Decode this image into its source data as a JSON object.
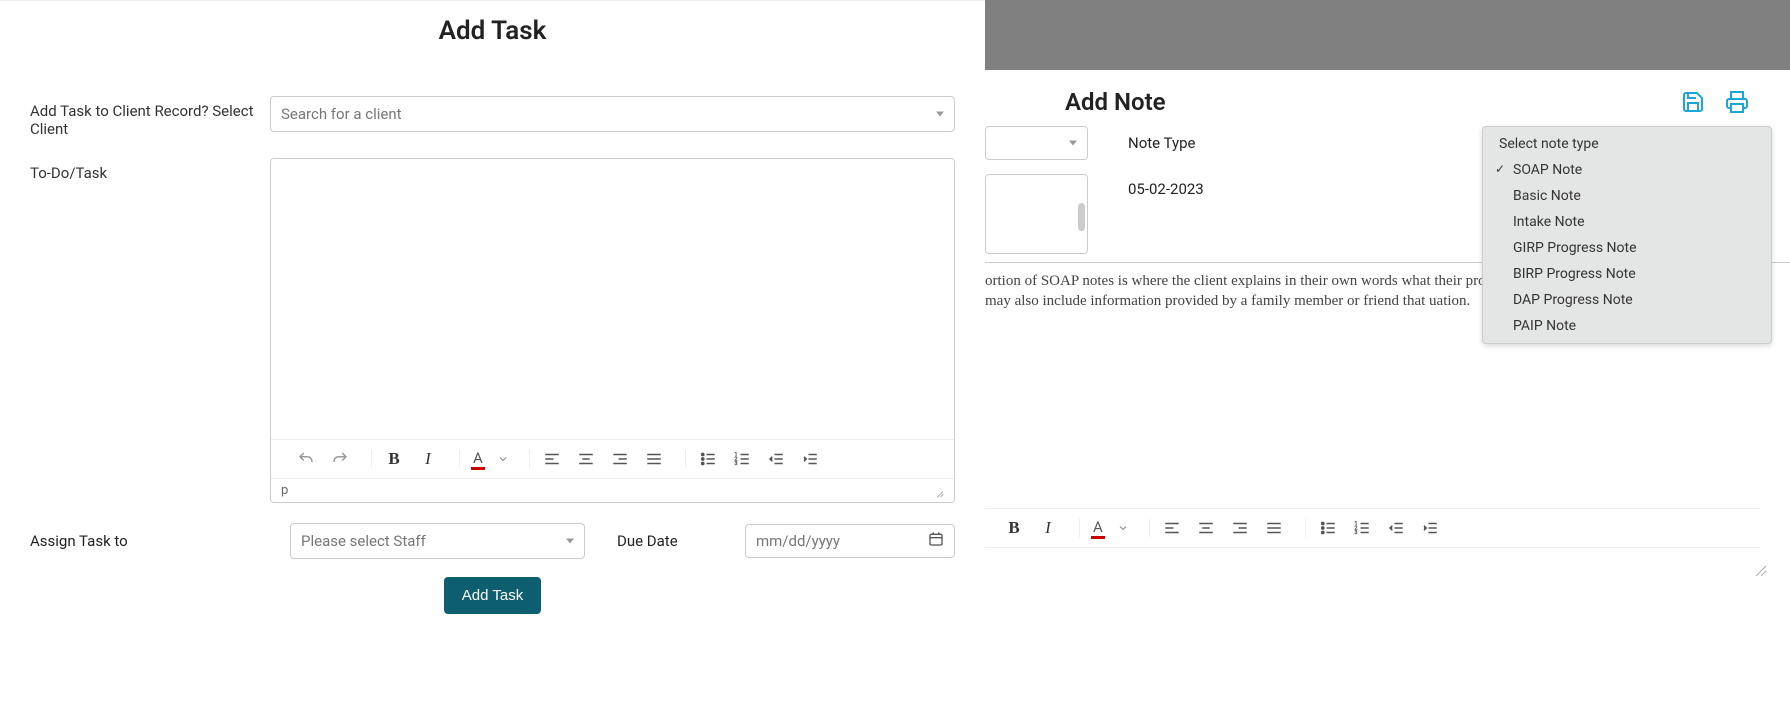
{
  "left": {
    "title": "Add Task",
    "client_label": "Add Task to Client Record? Select Client",
    "client_placeholder": "Search for a client",
    "todo_label": "To-Do/Task",
    "editor_status": "p",
    "assign_label": "Assign Task to",
    "staff_placeholder": "Please select Staff",
    "due_label": "Due Date",
    "date_placeholder": "mm/dd/yyyy",
    "submit_label": "Add Task"
  },
  "right": {
    "title": "Add Note",
    "note_type_label": "Note Type",
    "date_value": "05-02-2023",
    "dropdown": {
      "header": "Select note type",
      "options": [
        "SOAP Note",
        "Basic Note",
        "Intake Note",
        "GIRP Progress Note",
        "BIRP Progress Note",
        "DAP Progress Note",
        "PAIP Note"
      ],
      "selected": "SOAP Note"
    },
    "editor_text": "ortion of SOAP notes is where the client explains in their own words what their problem(s) is. This n of social worker case notes may also include information provided by a family member or friend that uation."
  }
}
